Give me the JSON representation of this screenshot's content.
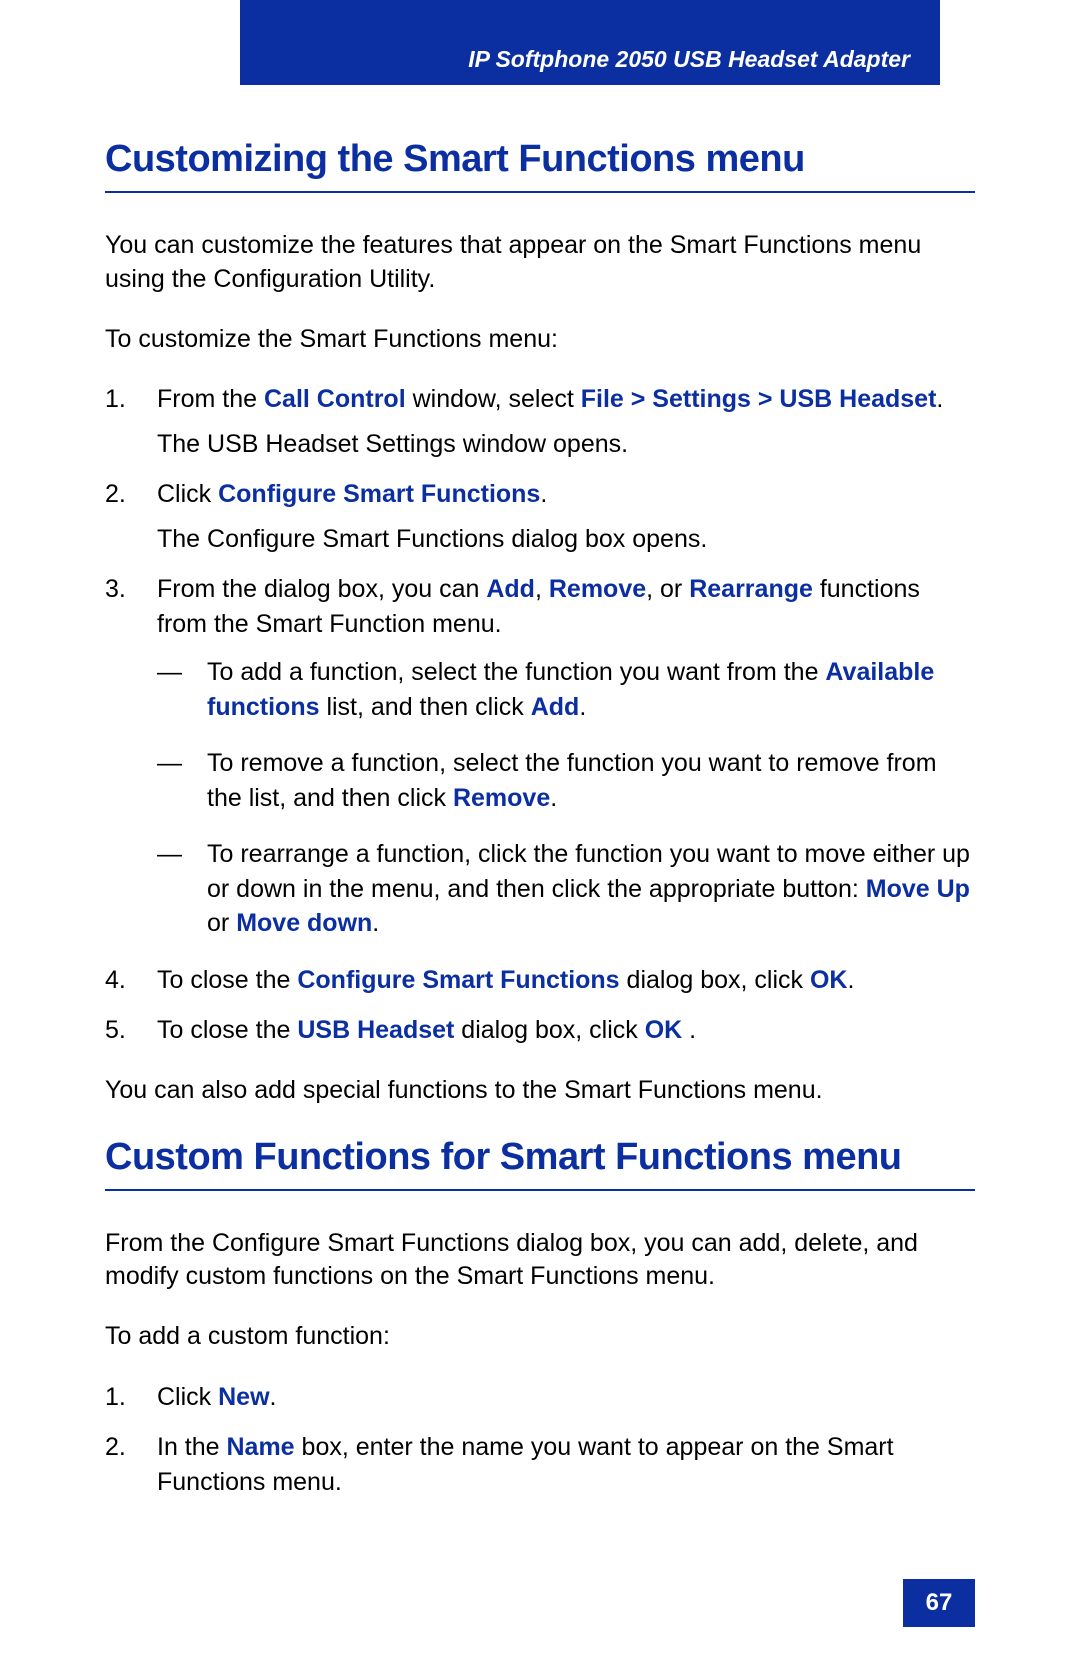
{
  "header": {
    "title": "IP Softphone 2050 USB Headset Adapter"
  },
  "section1": {
    "title": "Customizing the Smart Functions menu",
    "intro": "You can customize the features that appear on the Smart Functions menu using the Configuration Utility.",
    "lead": "To customize the Smart Functions menu:",
    "step1_pre": "From the ",
    "step1_b1": "Call Control",
    "step1_mid": " window, select ",
    "step1_b2": "File > Settings > USB Headset",
    "step1_post": ".",
    "step1_sub": "The USB Headset Settings window opens.",
    "step2_pre": "Click ",
    "step2_b1": "Configure Smart Functions",
    "step2_post": ".",
    "step2_sub": "The Configure Smart Functions dialog box opens.",
    "step3_pre": "From the dialog box, you can ",
    "step3_b1": "Add",
    "step3_mid1": ", ",
    "step3_b2": "Remove",
    "step3_mid2": ", or ",
    "step3_b3": "Rearrange",
    "step3_post": " functions from the Smart Function menu.",
    "dash1_pre": "To add a function, select the function you want from the ",
    "dash1_b1": "Available functions",
    "dash1_mid": " list, and then click ",
    "dash1_b2": "Add",
    "dash1_post": ".",
    "dash2_pre": "To remove a function, select the function you want to remove from the list, and then click ",
    "dash2_b1": "Remove",
    "dash2_post": ".",
    "dash3_pre": "To rearrange a function, click the function you want to move either up or down in the menu, and then click the appropriate button: ",
    "dash3_b1": "Move Up",
    "dash3_mid": " or ",
    "dash3_b2": "Move down",
    "dash3_post": ".",
    "step4_pre": "To close the ",
    "step4_b1": "Configure Smart Functions",
    "step4_mid": " dialog box, click ",
    "step4_b2": "OK",
    "step4_post": ".",
    "step5_pre": "To close the ",
    "step5_b1": "USB Headset",
    "step5_mid": " dialog box, click ",
    "step5_b2": "OK",
    "step5_post": " .",
    "closing": "You can also add special functions to the Smart Functions menu."
  },
  "section2": {
    "title": "Custom Functions for Smart Functions menu",
    "intro": "From the Configure Smart Functions dialog box, you can add, delete, and modify custom functions on the Smart Functions menu.",
    "lead": "To add a custom function:",
    "s1_pre": "Click ",
    "s1_b1": "New",
    "s1_post": ".",
    "s2_pre": "In the ",
    "s2_b1": "Name",
    "s2_post": " box, enter the name you want to appear on the Smart Functions menu."
  },
  "page_number": "67"
}
